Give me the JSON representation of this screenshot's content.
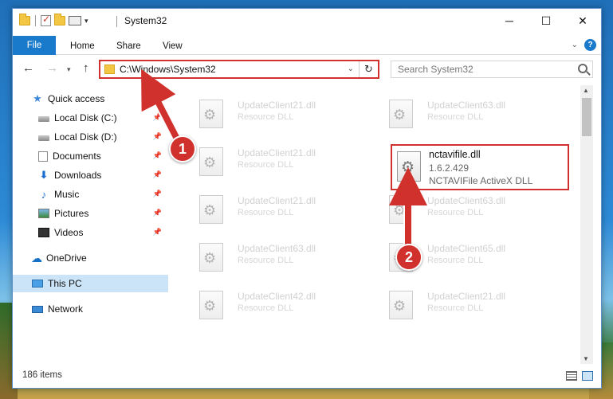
{
  "window": {
    "title": "System32",
    "minimize": "─",
    "maximize": "☐",
    "close": "✕"
  },
  "ribbon": {
    "tabs": [
      "File",
      "Home",
      "Share",
      "View"
    ],
    "help": "?"
  },
  "nav": {
    "back": "←",
    "forward": "→",
    "recent": "▾",
    "up": "↑",
    "address": "C:\\Windows\\System32",
    "refresh": "↻",
    "search_placeholder": "Search System32"
  },
  "sidebar": {
    "items": [
      {
        "label": "Quick access"
      },
      {
        "label": "Local Disk (C:)"
      },
      {
        "label": "Local Disk (D:)"
      },
      {
        "label": "Documents"
      },
      {
        "label": "Downloads"
      },
      {
        "label": "Music"
      },
      {
        "label": "Pictures"
      },
      {
        "label": "Videos"
      },
      {
        "label": "OneDrive"
      },
      {
        "label": "This PC"
      },
      {
        "label": "Network"
      }
    ]
  },
  "files": [
    {
      "name": "UpdateClient21.dll",
      "desc": "Resource DLL"
    },
    {
      "name": "UpdateClient63.dll",
      "desc": "Resource DLL"
    },
    {
      "name": "UpdateClient21.dll",
      "desc": "Resource DLL"
    },
    {
      "name": "UpdateClient21.dll",
      "desc": "Resource DLL"
    },
    {
      "name": "UpdateClient63.dll",
      "desc": "Resource DLL"
    },
    {
      "name": "UpdateClient63.dll",
      "desc": "Resource DLL"
    },
    {
      "name": "UpdateClient65.dll",
      "desc": "Resource DLL"
    },
    {
      "name": "UpdateClient42.dll",
      "desc": "Resource DLL"
    },
    {
      "name": "UpdateClient21.dll",
      "desc": "Resource DLL"
    }
  ],
  "highlighted_file": {
    "name": "nctavifile.dll",
    "version": "1.6.2.429",
    "desc": "NCTAVIFile ActiveX DLL"
  },
  "status": {
    "items": "186 items"
  },
  "annotations": {
    "step1": "1",
    "step2": "2",
    "color": "#d0312d"
  }
}
